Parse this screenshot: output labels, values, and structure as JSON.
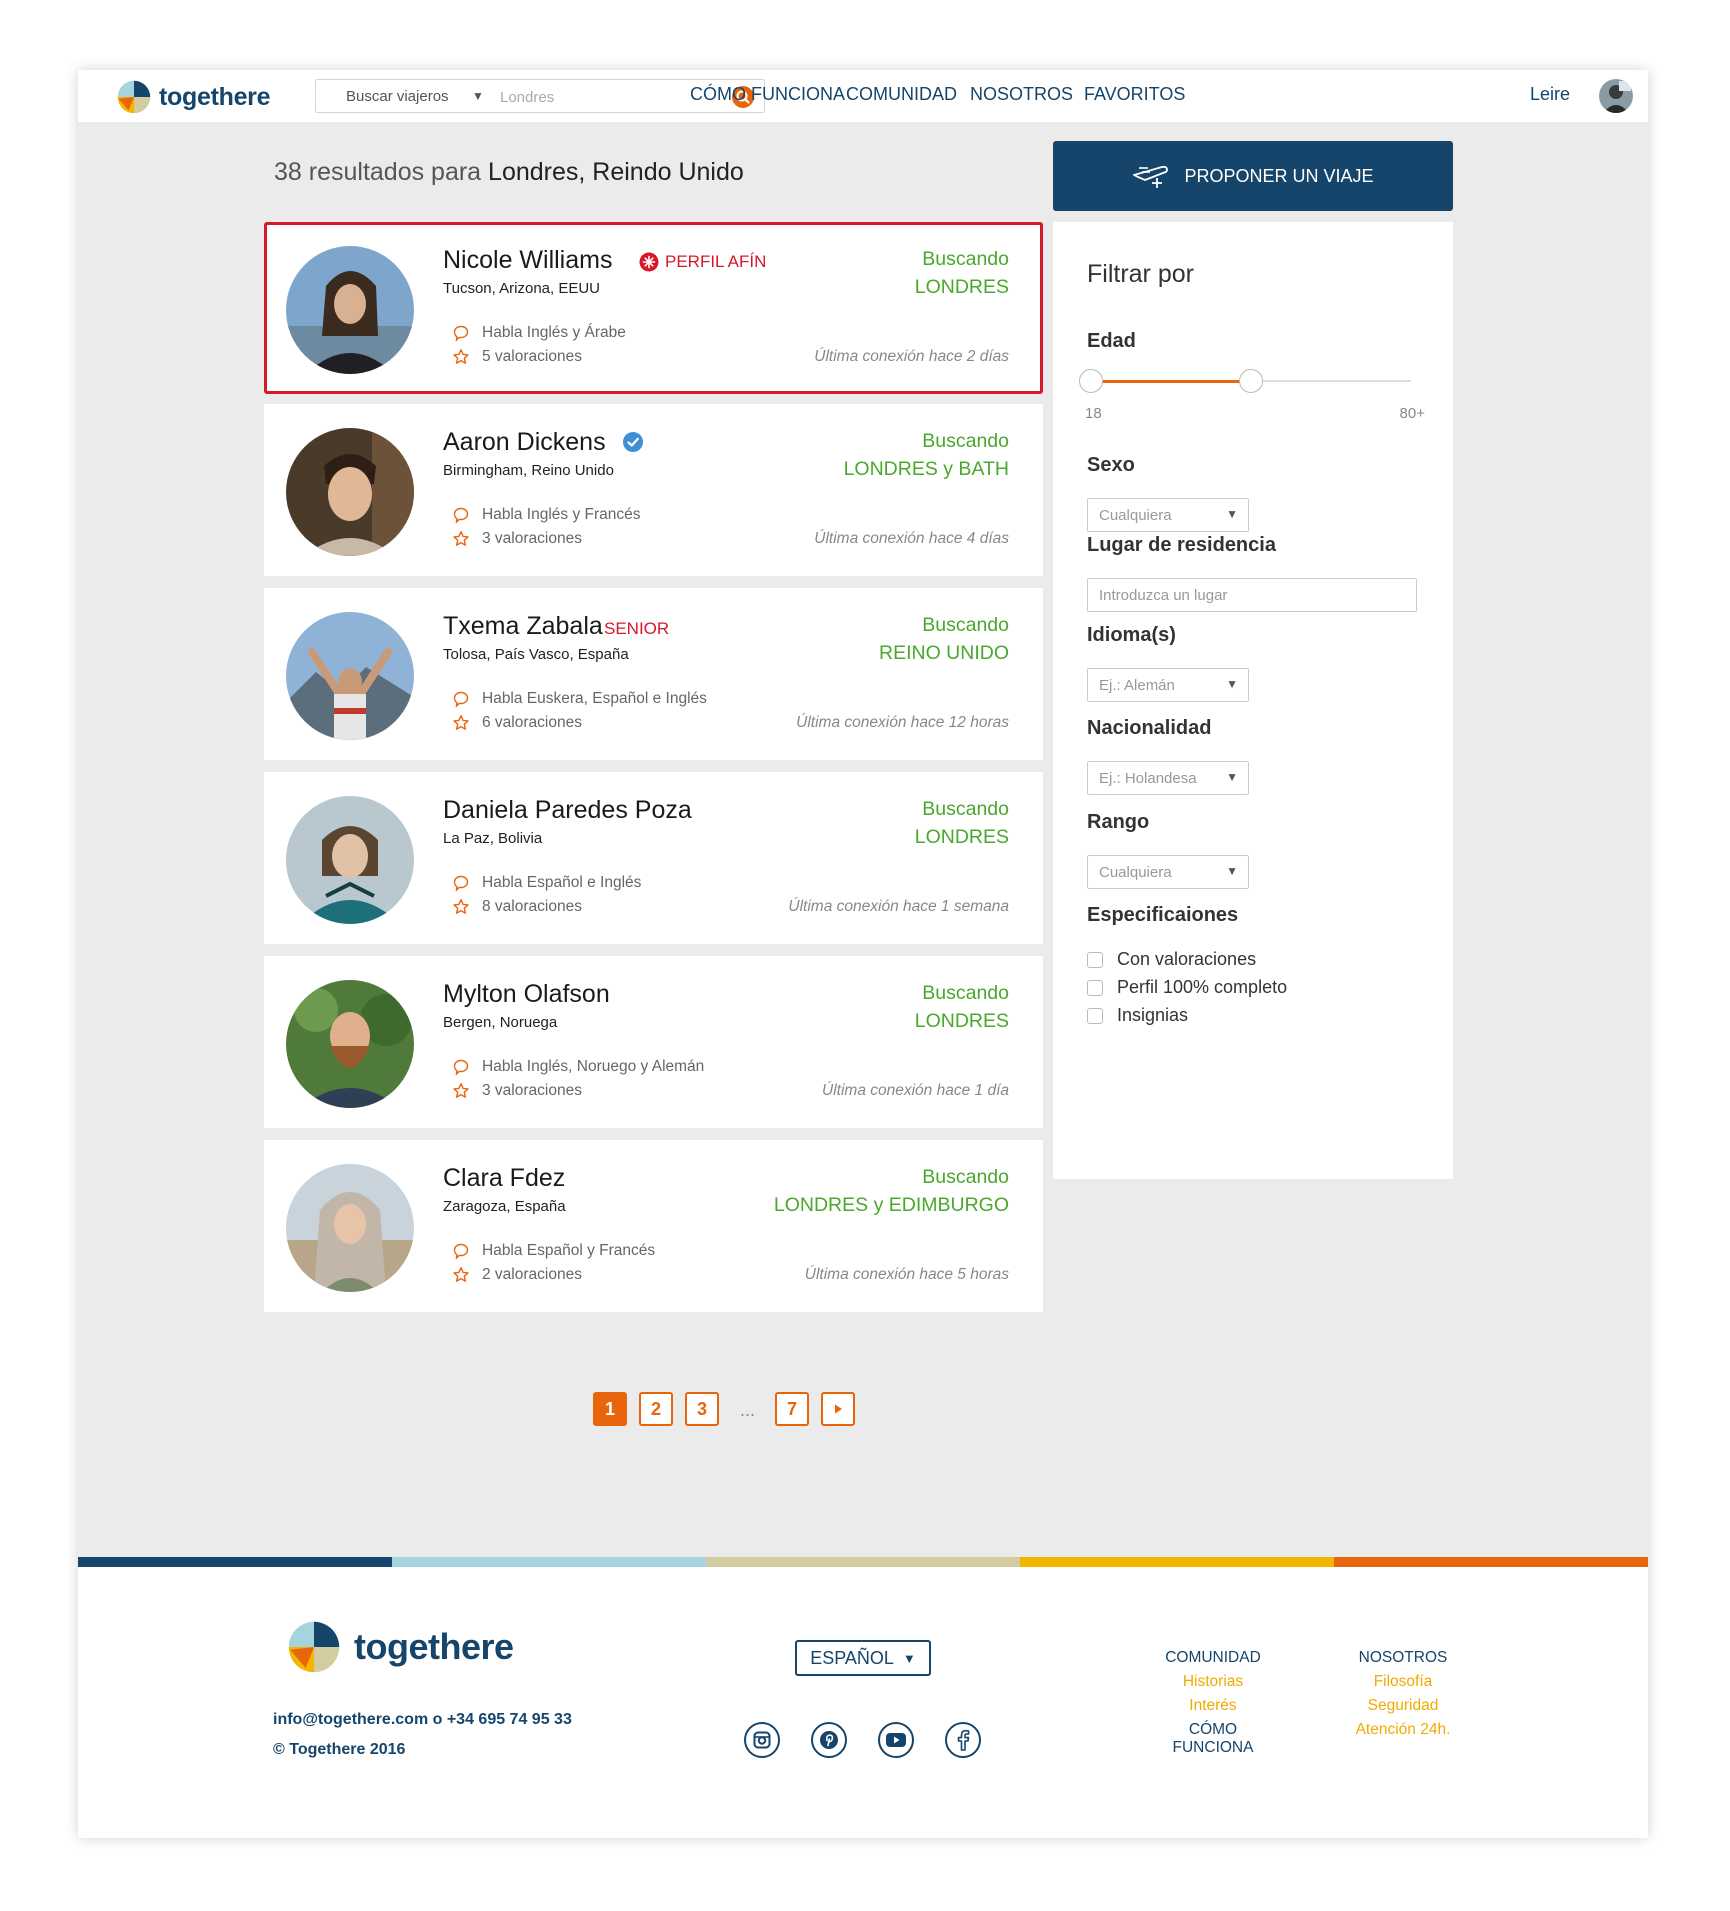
{
  "header": {
    "logo_text": "togethere",
    "search_category": "Buscar viajeros",
    "search_placeholder": "Londres",
    "nav": [
      "CÓMO FUNCIONA",
      "COMUNIDAD",
      "NOSOTROS",
      "FAVORITOS"
    ],
    "user_name": "Leire"
  },
  "results": {
    "count_text": "38 resultados para",
    "location": "Londres, Reindo Unido"
  },
  "cards": [
    {
      "name": "Nicole Williams",
      "badge": "PERFIL AFÍN",
      "location": "Tucson, Arizona, EEUU",
      "languages": "Habla Inglés y Árabe",
      "ratings": "5 valoraciones",
      "search_label": "Buscando",
      "destination": "LONDRES",
      "last_connection": "Última conexión hace 2 días"
    },
    {
      "name": "Aaron Dickens",
      "badge": "",
      "location": "Birmingham, Reino Unido",
      "languages": "Habla Inglés y Francés",
      "ratings": "3 valoraciones",
      "search_label": "Buscando",
      "destination": "LONDRES y BATH",
      "last_connection": "Última conexión hace 4 días"
    },
    {
      "name": "Txema Zabala",
      "badge": "SENIOR",
      "location": "Tolosa, País Vasco, España",
      "languages": "Habla Euskera, Español e Inglés",
      "ratings": "6 valoraciones",
      "search_label": "Buscando",
      "destination": "REINO UNIDO",
      "last_connection": "Última conexión hace 12 horas"
    },
    {
      "name": "Daniela Paredes Poza",
      "badge": "",
      "location": "La Paz, Bolivia",
      "languages": "Habla Español e Inglés",
      "ratings": "8 valoraciones",
      "search_label": "Buscando",
      "destination": "LONDRES",
      "last_connection": "Última conexión hace 1 semana"
    },
    {
      "name": "Mylton Olafson",
      "badge": "",
      "location": "Bergen, Noruega",
      "languages": "Habla Inglés, Noruego y Alemán",
      "ratings": "3 valoraciones",
      "search_label": "Buscando",
      "destination": "LONDRES",
      "last_connection": "Última conexión hace 1 día"
    },
    {
      "name": "Clara Fdez",
      "badge": "",
      "location": "Zaragoza, España",
      "languages": "Habla Español y Francés",
      "ratings": "2 valoraciones",
      "search_label": "Buscando",
      "destination": "LONDRES y EDIMBURGO",
      "last_connection": "Última conexión hace 5 horas"
    }
  ],
  "sidebar": {
    "propose_label": "PROPONER UN VIAJE",
    "filter_title": "Filtrar por",
    "age_label": "Edad",
    "age_min": "18",
    "age_max": "80+",
    "age_range_selected": [
      0,
      0.5
    ],
    "sex_label": "Sexo",
    "sex_value": "Cualquiera",
    "residence_label": "Lugar de residencia",
    "residence_placeholder": "Introduzca un lugar",
    "language_label": "Idioma(s)",
    "language_value": "Ej.: Alemán",
    "nationality_label": "Nacionalidad",
    "nationality_value": "Ej.: Holandesa",
    "rank_label": "Rango",
    "rank_value": "Cualquiera",
    "specs_label": "Especificaiones",
    "specs": [
      "Con valoraciones",
      "Perfil 100% completo",
      "Insignias"
    ]
  },
  "pagination": {
    "pages": [
      "1",
      "2",
      "3",
      "7"
    ],
    "ellipsis": "...",
    "active": "1"
  },
  "footer": {
    "logo_text": "togethere",
    "contact": "info@togethere.com o +34 695 74 95 33",
    "copyright": "© Togethere 2016",
    "language": "ESPAÑOL",
    "col1": {
      "title": "COMUNIDAD",
      "links": [
        "Historias",
        "Interés"
      ],
      "extra": "CÓMO FUNCIONA"
    },
    "col2": {
      "title": "NOSOTROS",
      "links": [
        "Filosofía",
        "Seguridad",
        "Atención 24h."
      ]
    }
  },
  "colors": {
    "brand_navy": "#16456b",
    "accent_orange": "#e8650b",
    "success_green": "#4aa82c",
    "alert_red": "#d7182a",
    "footer_bar": [
      "#16456b",
      "#a6d4de",
      "#d2cca0",
      "#f2b500",
      "#e8650b"
    ]
  }
}
